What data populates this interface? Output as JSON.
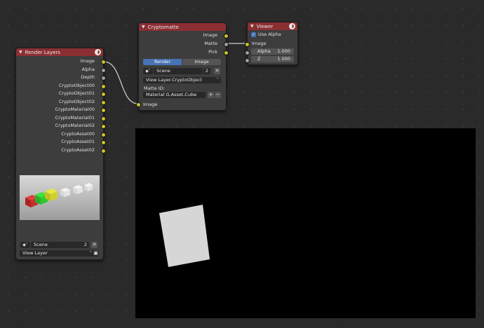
{
  "render_layers": {
    "title": "Render Layers",
    "outputs": [
      "Image",
      "Alpha",
      "Depth",
      "CryptoObject00",
      "CryptoObject01",
      "CryptoObject02",
      "CryptoMaterial00",
      "CryptoMaterial01",
      "CryptoMaterial02",
      "CryptoAsset00",
      "CryptoAsset01",
      "CryptoAsset02"
    ],
    "scene": "Scene",
    "users": "2",
    "view_layer": "View Layer"
  },
  "cryptomatte": {
    "title": "Cryptomatte",
    "outputs": [
      "Image",
      "Matte",
      "Pick"
    ],
    "tab_render": "Render",
    "tab_image": "Image",
    "scene": "Scene",
    "users": "2",
    "layer": "View Layer.CryptoObject",
    "matte_id_label": "Matte ID:",
    "matte_id": "Material G,Asset,Cube",
    "input_image": "Image"
  },
  "viewer": {
    "title": "Viewer",
    "use_alpha_label": "Use Alpha",
    "input_image": "Image",
    "alpha_label": "Alpha",
    "alpha_value": "1.000",
    "z_label": "Z",
    "z_value": "1.000"
  },
  "icons": [
    "render-icon",
    "scene-icon",
    "close-icon",
    "plus-icon",
    "minus-icon",
    "chevron-down-icon",
    "checkbox-icon"
  ],
  "colors": {
    "header": "#8b2f33",
    "socket_image": "#c7c729",
    "socket_value": "#a1a1a1",
    "accent": "#4772b3"
  }
}
